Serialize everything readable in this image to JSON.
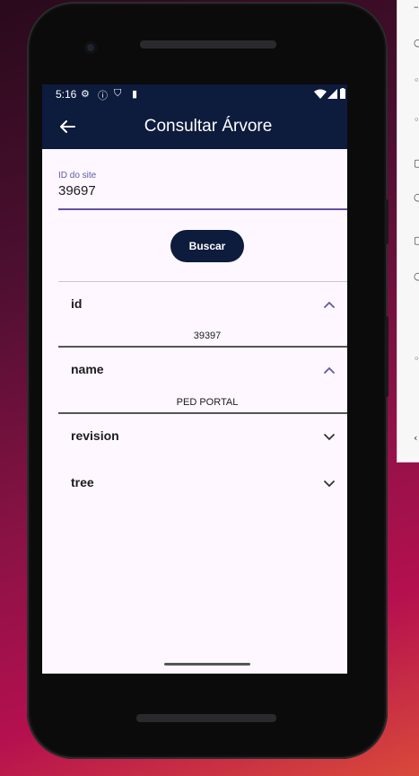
{
  "status_bar": {
    "time": "5:16"
  },
  "app_bar": {
    "title": "Consultar Árvore"
  },
  "form": {
    "site_id_label": "ID do site",
    "site_id_value": "39697",
    "search_button": "Buscar"
  },
  "panels": [
    {
      "title": "id",
      "expanded": true,
      "content": "39397"
    },
    {
      "title": "name",
      "expanded": true,
      "content": "PED PORTAL"
    },
    {
      "title": "revision",
      "expanded": false
    },
    {
      "title": "tree",
      "expanded": false
    }
  ],
  "colors": {
    "app_bar": "#0d1b3d",
    "screen_background": "#fef7ff",
    "accent": "#6750a4"
  }
}
